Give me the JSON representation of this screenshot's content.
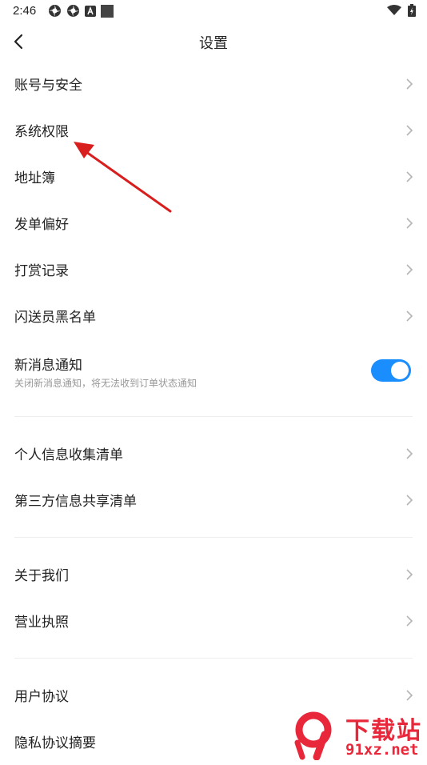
{
  "status_bar": {
    "time": "2:46",
    "icons": [
      "settings-gear-icon",
      "settings-gear-icon",
      "a-box-icon",
      "square-icon",
      "wifi-icon",
      "battery-icon"
    ]
  },
  "header": {
    "title": "设置",
    "back_icon": "chevron-left-icon"
  },
  "settings": {
    "items": [
      {
        "label": "账号与安全"
      },
      {
        "label": "系统权限"
      },
      {
        "label": "地址簿"
      },
      {
        "label": "发单偏好"
      },
      {
        "label": "打赏记录"
      },
      {
        "label": "闪送员黑名单"
      }
    ],
    "notify": {
      "label": "新消息通知",
      "desc": "关闭新消息通知，将无法收到订单状态通知",
      "enabled": true
    },
    "privacy_items": [
      {
        "label": "个人信息收集清单"
      },
      {
        "label": "第三方信息共享清单"
      }
    ],
    "about_items": [
      {
        "label": "关于我们"
      },
      {
        "label": "营业执照"
      }
    ],
    "legal_items": [
      {
        "label": "用户协议"
      },
      {
        "label": "隐私协议摘要"
      }
    ]
  },
  "colors": {
    "accent": "#1a8dff",
    "annotation_arrow": "#d91e1e",
    "watermark_red": "#e8283a"
  },
  "watermark": {
    "big_text": "下载站",
    "small_text": "91xz.net"
  }
}
